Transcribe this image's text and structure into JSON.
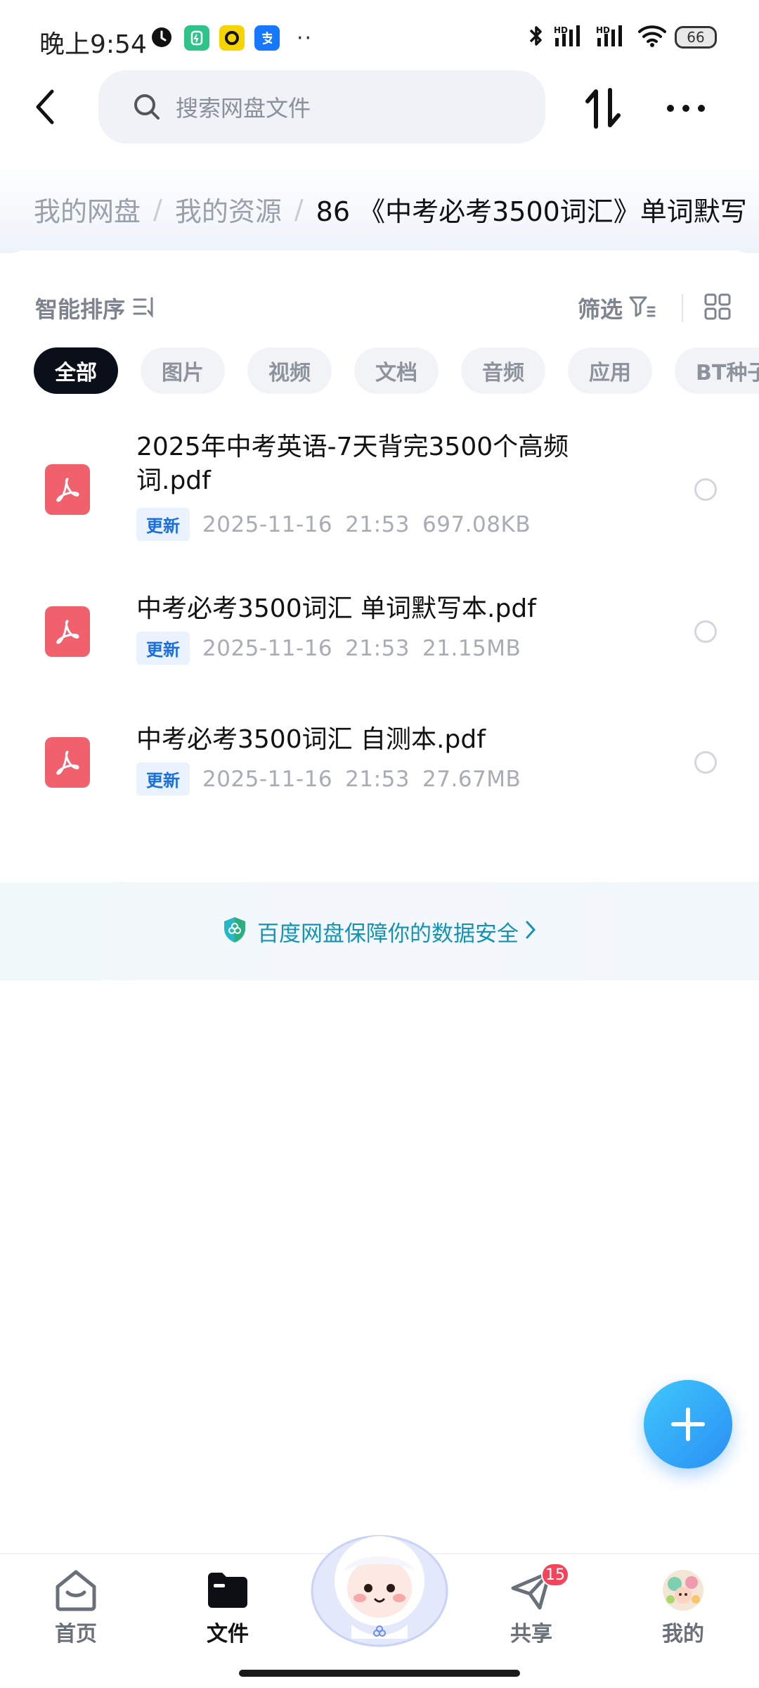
{
  "status_bar": {
    "time": "晚上9:54",
    "battery": "66"
  },
  "header": {
    "search_placeholder": "搜索网盘文件"
  },
  "breadcrumb": {
    "items": [
      "我的网盘",
      "我的资源",
      "86 《中考必考3500词汇》单词默写"
    ]
  },
  "toolbar": {
    "sort_label": "智能排序",
    "filter_label": "筛选"
  },
  "filter_chips": [
    {
      "label": "全部",
      "selected": true
    },
    {
      "label": "图片",
      "selected": false
    },
    {
      "label": "视频",
      "selected": false
    },
    {
      "label": "文档",
      "selected": false
    },
    {
      "label": "音频",
      "selected": false
    },
    {
      "label": "应用",
      "selected": false
    },
    {
      "label": "BT种子",
      "selected": false
    }
  ],
  "files": [
    {
      "name": "2025年中考英语-7天背完3500个高频词.pdf",
      "badge": "更新",
      "date": "2025-11-16",
      "time": "21:53",
      "size": "697.08KB"
    },
    {
      "name": "中考必考3500词汇 单词默写本.pdf",
      "badge": "更新",
      "date": "2025-11-16",
      "time": "21:53",
      "size": "21.15MB"
    },
    {
      "name": "中考必考3500词汇 自测本.pdf",
      "badge": "更新",
      "date": "2025-11-16",
      "time": "21:53",
      "size": "27.67MB"
    }
  ],
  "security_banner": {
    "text": "百度网盘保障你的数据安全"
  },
  "bottom_nav": {
    "home": "首页",
    "files": "文件",
    "share": "共享",
    "share_badge": "15",
    "mine": "我的"
  },
  "colors": {
    "accent": "#2a8ef5",
    "pdf_red": "#f0606d",
    "badge_blue": "#1a6fe0",
    "security_teal": "#1593b5"
  }
}
